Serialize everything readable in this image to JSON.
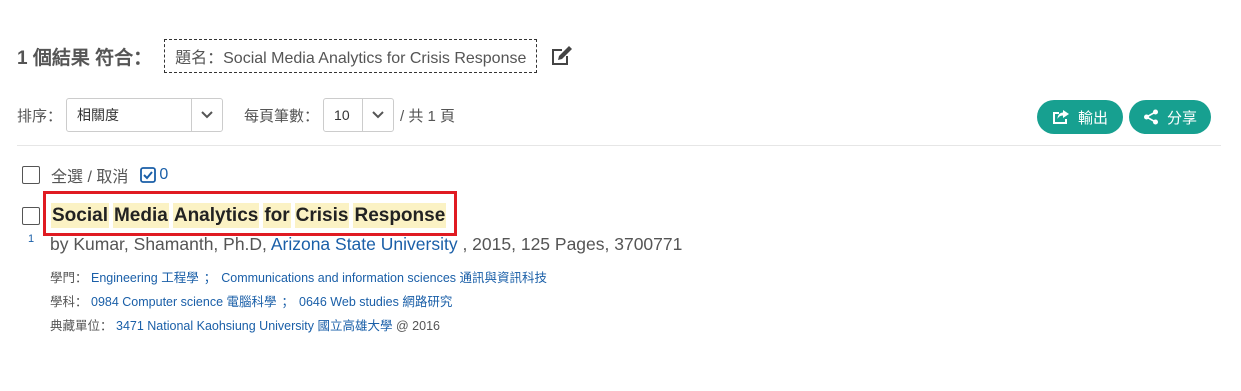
{
  "summary": {
    "count_text": "1 個結果 符合：",
    "query_text": "題名：Social Media Analytics for Crisis Response"
  },
  "controls": {
    "sort_label": "排序：",
    "sort_value": "相關度",
    "per_page_label": "每頁筆數：",
    "per_page_value": "10",
    "total_pages_text": "/ 共 1 頁"
  },
  "actions": {
    "export_label": "輸出",
    "share_label": "分享"
  },
  "selection": {
    "select_all_label": "全選 / 取消",
    "selected_count": "0"
  },
  "record": {
    "index": "1",
    "title_words": [
      "Social",
      "Media",
      "Analytics",
      "for",
      "Crisis",
      "Response"
    ],
    "by_prefix": "by Kumar, Shamanth, Ph.D,",
    "institution": "Arizona State University",
    "by_suffix": ", 2015, 125 Pages, 3700771",
    "discipline_label": "學門：",
    "disciplines": [
      "Engineering 工程學",
      "Communications and information sciences 通訊與資訊科技"
    ],
    "subject_label": "學科：",
    "subjects": [
      "0984 Computer science 電腦科學",
      "0646 Web studies 網路研究"
    ],
    "holding_label": "典藏單位：",
    "holding_link": "3471 National Kaohsiung University 國立高雄大學",
    "holding_suffix": "@ 2016",
    "separator": "；"
  },
  "colors": {
    "accent": "#17a090",
    "link": "#1a5fa8",
    "highlight": "#fbf2c4",
    "focus_box": "#e01b22"
  }
}
